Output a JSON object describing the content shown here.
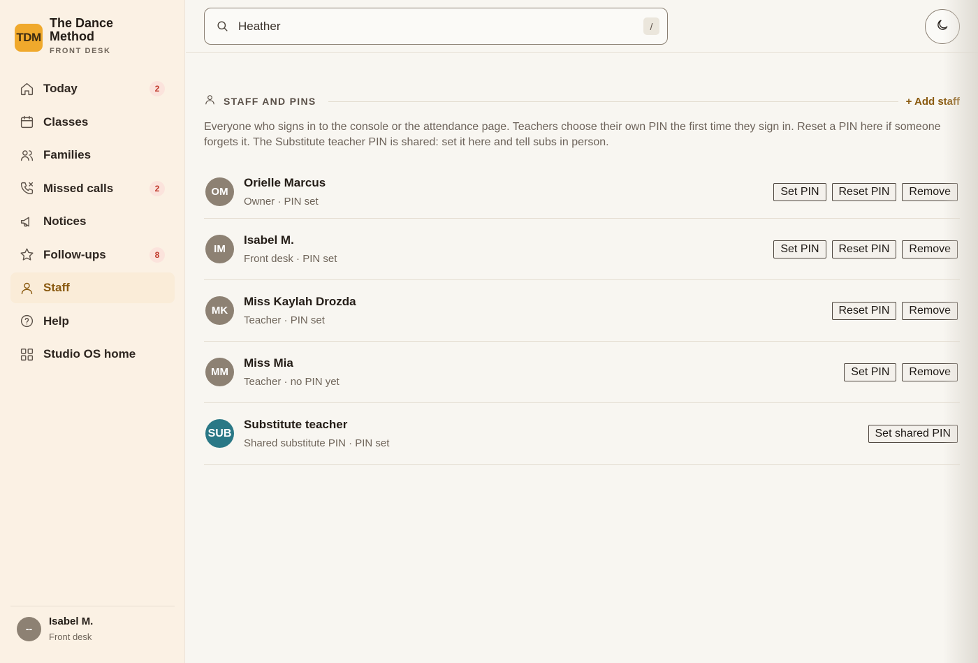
{
  "brand": {
    "logo": "TDM",
    "name": "The Dance Method",
    "subtitle": "FRONT DESK"
  },
  "sidebar": {
    "items": [
      {
        "label": "Today",
        "icon": "home-icon",
        "badge": "2"
      },
      {
        "label": "Classes",
        "icon": "calendar-icon"
      },
      {
        "label": "Families",
        "icon": "users-icon"
      },
      {
        "label": "Missed calls",
        "icon": "phone-missed-icon",
        "badge": "2"
      },
      {
        "label": "Notices",
        "icon": "megaphone-icon"
      },
      {
        "label": "Follow-ups",
        "icon": "star-icon",
        "badge": "8"
      },
      {
        "label": "Staff",
        "icon": "person-icon",
        "active": true
      },
      {
        "label": "Help",
        "icon": "help-icon"
      },
      {
        "label": "Studio OS home",
        "icon": "grid-icon"
      }
    ]
  },
  "user": {
    "initials": "--",
    "name": "Isabel M.",
    "role": "Front desk"
  },
  "search": {
    "value": "Heather",
    "shortcut": "/"
  },
  "section": {
    "title": "STAFF AND PINS",
    "add_label": "+ Add staff",
    "description": "Everyone who signs in to the console or the attendance page. Teachers choose their own PIN the first time they sign in. Reset a PIN here if someone forgets it. The Substitute teacher PIN is shared: set it here and tell subs in person."
  },
  "staff": [
    {
      "initials": "OM",
      "name": "Orielle Marcus",
      "meta": "Owner · PIN set",
      "actions": [
        "Set PIN",
        "Reset PIN",
        "Remove"
      ]
    },
    {
      "initials": "IM",
      "name": "Isabel M.",
      "meta": "Front desk · PIN set",
      "actions": [
        "Set PIN",
        "Reset PIN",
        "Remove"
      ]
    },
    {
      "initials": "MK",
      "name": "Miss Kaylah Drozda",
      "meta": "Teacher · PIN set",
      "actions": [
        "Reset PIN",
        "Remove"
      ]
    },
    {
      "initials": "MM",
      "name": "Miss Mia",
      "meta": "Teacher · no PIN yet",
      "actions": [
        "Set PIN",
        "Remove"
      ]
    },
    {
      "initials": "SUB",
      "name": "Substitute teacher",
      "meta": "Shared substitute PIN · PIN set",
      "actions": [
        "Set shared PIN"
      ]
    }
  ]
}
